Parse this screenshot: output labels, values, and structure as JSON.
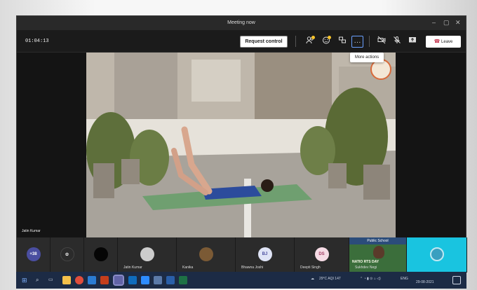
{
  "window": {
    "title": "Meeting now"
  },
  "toolbar": {
    "timer": "01:04:13",
    "request_control_label": "Request control",
    "leave_label": "Leave",
    "more_actions_tooltip": "More actions",
    "more_glyph": "···"
  },
  "stage": {
    "presenter_name": "Jatin Kumar"
  },
  "participants": {
    "overflow_count": "+38",
    "tiles": [
      {
        "name": "Jatin Kumar"
      },
      {
        "name": "Kanika"
      },
      {
        "name": "Bhawna Joshi",
        "initials": "BJ"
      },
      {
        "name": "Deepti Singh",
        "initials": "DS"
      },
      {
        "name": "Sukhdev Negi"
      }
    ],
    "video_tile_banner": "Public School",
    "video_tile_caption": "NATIO  RTS DAY"
  },
  "taskbar": {
    "weather": "29°C AQI 147",
    "language": "ENG",
    "time": "",
    "date": "29-08-2021"
  },
  "colors": {
    "accent": "#6264a7",
    "overflow_avatar": "#4a4ea0",
    "initials_bj": "#dfe4f6",
    "initials_ds": "#f6dbe5",
    "leave_icon": "#c4314b"
  }
}
